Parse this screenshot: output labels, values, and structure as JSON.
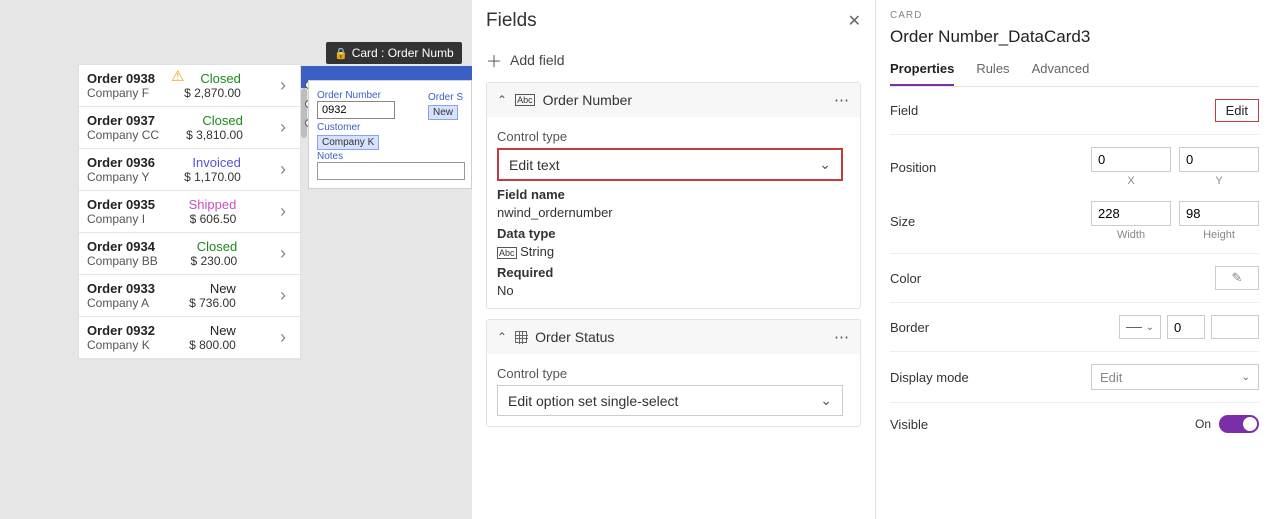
{
  "canvas": {
    "card_tag": "Card : Order Numb",
    "orders": [
      {
        "title": "Order 0938",
        "company": "Company F",
        "status": "Closed",
        "status_class": "status-closed",
        "amount": "$ 2,870.00",
        "warn": true
      },
      {
        "title": "Order 0937",
        "company": "Company CC",
        "status": "Closed",
        "status_class": "status-closed",
        "amount": "$ 3,810.00"
      },
      {
        "title": "Order 0936",
        "company": "Company Y",
        "status": "Invoiced",
        "status_class": "status-invoiced",
        "amount": "$ 1,170.00"
      },
      {
        "title": "Order 0935",
        "company": "Company I",
        "status": "Shipped",
        "status_class": "status-shipped",
        "amount": "$ 606.50"
      },
      {
        "title": "Order 0934",
        "company": "Company BB",
        "status": "Closed",
        "status_class": "status-closed",
        "amount": "$ 230.00"
      },
      {
        "title": "Order 0933",
        "company": "Company A",
        "status": "New",
        "status_class": "status-new",
        "amount": "$ 736.00"
      },
      {
        "title": "Order 0932",
        "company": "Company K",
        "status": "New",
        "status_class": "status-new",
        "amount": "$ 800.00"
      }
    ],
    "card": {
      "order_number_label": "Order Number",
      "order_number_value": "0932",
      "order_status_label": "Order S",
      "order_status_badge": "New",
      "customer_label": "Customer",
      "customer_badge": "Company K",
      "notes_label": "Notes"
    }
  },
  "fields_pane": {
    "title": "Fields",
    "add_label": "Add field",
    "group1": {
      "title": "Order Number",
      "control_type_label": "Control type",
      "control_type_value": "Edit text",
      "field_name_label": "Field name",
      "field_name_value": "nwind_ordernumber",
      "data_type_label": "Data type",
      "data_type_value": "String",
      "required_label": "Required",
      "required_value": "No"
    },
    "group2": {
      "title": "Order Status",
      "control_type_label": "Control type",
      "control_type_value": "Edit option set single-select"
    }
  },
  "props_pane": {
    "caption": "CARD",
    "object_name": "Order Number_DataCard3",
    "tabs": {
      "properties": "Properties",
      "rules": "Rules",
      "advanced": "Advanced"
    },
    "field_label": "Field",
    "field_action": "Edit",
    "position_label": "Position",
    "position_x": "0",
    "position_y": "0",
    "x_lbl": "X",
    "y_lbl": "Y",
    "size_label": "Size",
    "size_w": "228",
    "size_h": "98",
    "w_lbl": "Width",
    "h_lbl": "Height",
    "color_label": "Color",
    "border_label": "Border",
    "border_width": "0",
    "display_mode_label": "Display mode",
    "display_mode_value": "Edit",
    "visible_label": "Visible",
    "visible_state": "On"
  }
}
